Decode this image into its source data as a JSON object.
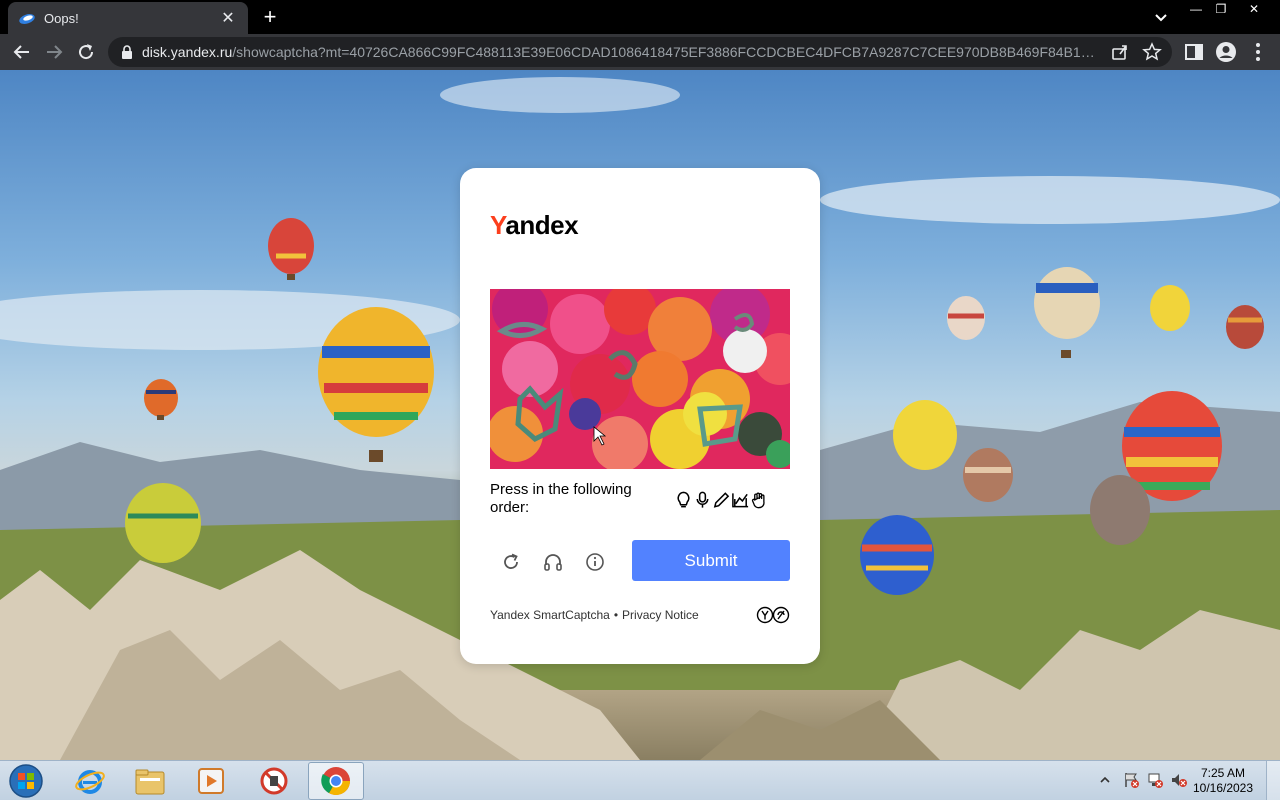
{
  "browser": {
    "tab_title": "Oops!",
    "new_tab_label": "+",
    "tab_close_label": "✕",
    "url_host": "disk.yandex.ru",
    "url_path": "/showcaptcha?mt=40726CA866C99FC488113E39E06CDAD1086418475EF3886FCCDCBEC4DFCB7A9287C7CEE970DB8B469F84B10EE1DBCEF...",
    "window_controls": {
      "minimize": "—",
      "maximize": "❐",
      "close": "✕"
    }
  },
  "captcha": {
    "logo_first_letter": "Y",
    "logo_rest": "andex",
    "instruction": "Press in the following order:",
    "order_icons": [
      "lightbulb-icon",
      "microphone-icon",
      "pencil-icon",
      "chart-icon",
      "hand-icon"
    ],
    "submit_label": "Submit",
    "controls": [
      "refresh-icon",
      "headphones-icon",
      "info-icon"
    ],
    "footer": {
      "product": "Yandex SmartCaptcha",
      "separator": "•",
      "privacy": "Privacy Notice"
    },
    "colors": {
      "submit": "#5282ff",
      "logo_accent": "#fc3f1d"
    }
  },
  "taskbar": {
    "time": "7:25 AM",
    "date": "10/16/2023",
    "apps": [
      "internet-explorer-icon",
      "file-explorer-icon",
      "media-player-icon",
      "blocked-app-icon",
      "chrome-icon"
    ]
  }
}
